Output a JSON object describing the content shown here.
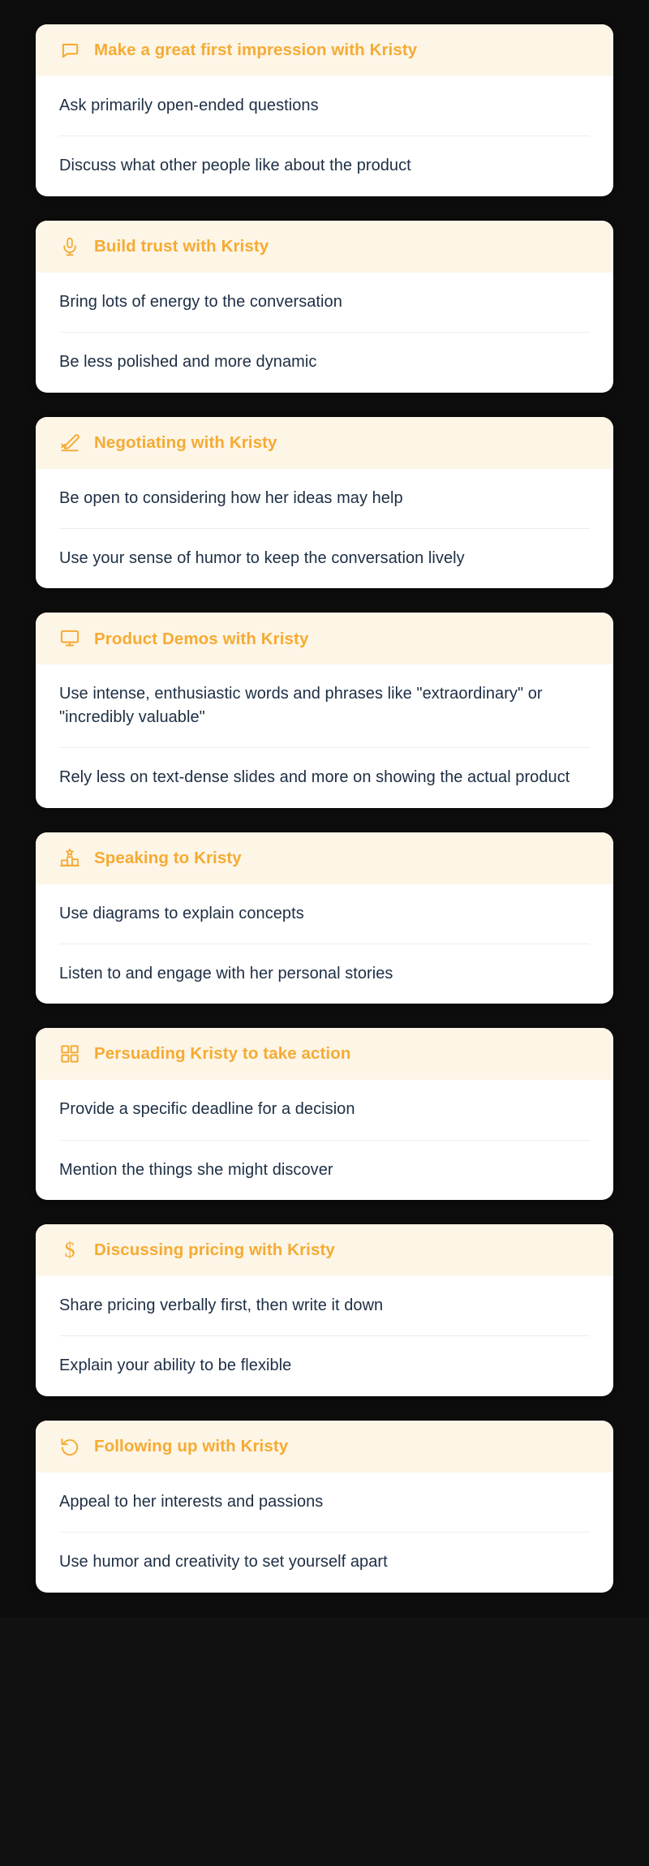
{
  "theme": {
    "page_background": "#0d0d0d",
    "card_background": "#ffffff",
    "header_background": "#fdf5e6",
    "accent": "#f5ab33",
    "body_text": "#1d2e44",
    "divider": "#ededed"
  },
  "cards": [
    {
      "icon": "chat-bubble-icon",
      "title": "Make a great first impression with Kristy",
      "items": [
        "Ask primarily open-ended questions",
        "Discuss what other people like about the product"
      ]
    },
    {
      "icon": "microphone-icon",
      "title": "Build trust with Kristy",
      "items": [
        "Bring lots of energy to the conversation",
        "Be less polished and more dynamic"
      ]
    },
    {
      "icon": "signature-pen-icon",
      "title": "Negotiating with Kristy",
      "items": [
        "Be open to considering how her ideas may help",
        "Use your sense of humor to keep the conversation lively"
      ]
    },
    {
      "icon": "monitor-icon",
      "title": "Product Demos with Kristy",
      "items": [
        "Use intense, enthusiastic words and phrases like \"extraordinary\" or \"incredibly valuable\"",
        "Rely less on text-dense slides and more on showing the actual product"
      ]
    },
    {
      "icon": "podium-star-icon",
      "title": "Speaking to Kristy",
      "items": [
        "Use diagrams to explain concepts",
        "Listen to and engage with her personal stories"
      ]
    },
    {
      "icon": "grid-four-icon",
      "title": "Persuading Kristy to take action",
      "items": [
        "Provide a specific deadline for a decision",
        "Mention the things she might discover"
      ]
    },
    {
      "icon": "dollar-sign-icon",
      "title": "Discussing pricing with Kristy",
      "items": [
        "Share pricing verbally first, then write it down",
        "Explain your ability to be flexible"
      ]
    },
    {
      "icon": "rotate-ccw-icon",
      "title": "Following up with Kristy",
      "items": [
        "Appeal to her interests and passions",
        "Use humor and creativity to set yourself apart"
      ]
    }
  ]
}
